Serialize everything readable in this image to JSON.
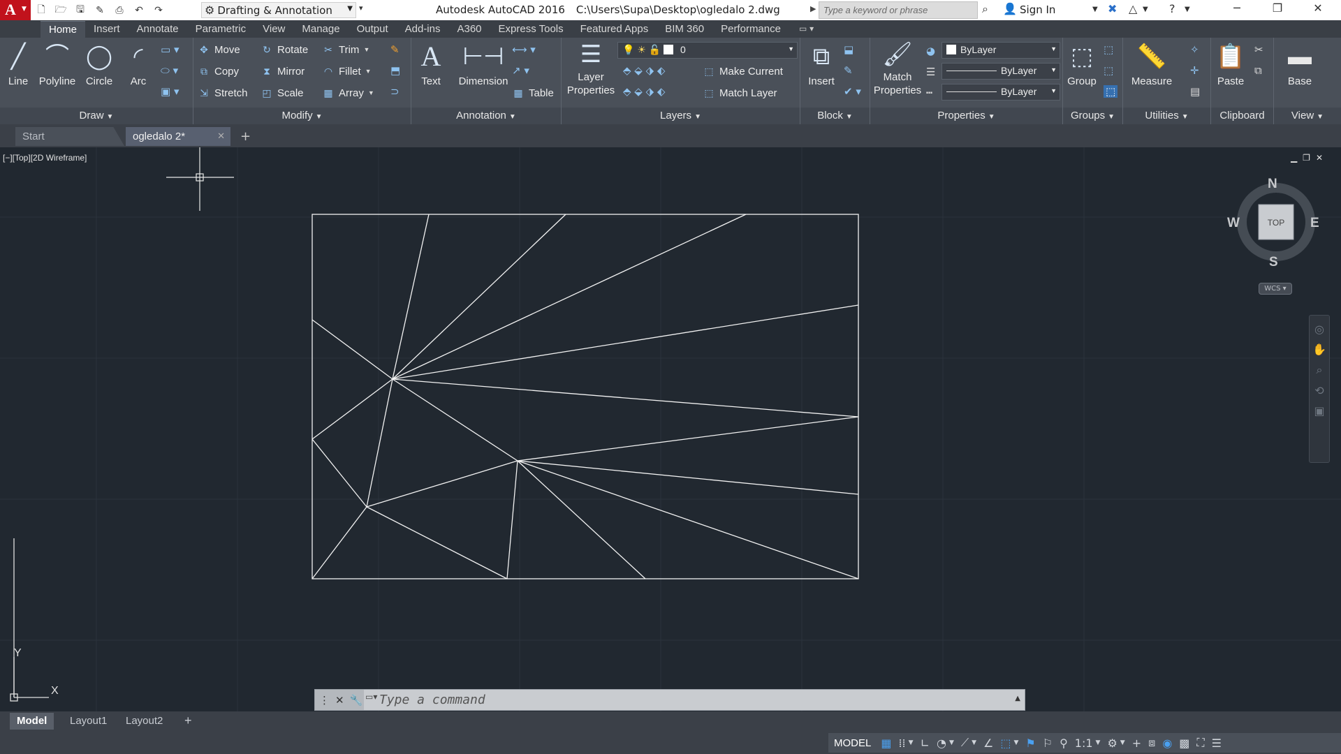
{
  "titlebar": {
    "app_name": "Autodesk AutoCAD 2016",
    "file_path": "C:\\Users\\Supa\\Desktop\\ogledalo 2.dwg",
    "workspace": "Drafting & Annotation",
    "search_placeholder": "Type a keyword or phrase",
    "sign_in": "Sign In",
    "app_logo_letter": "A"
  },
  "ribbon_tabs": [
    "Home",
    "Insert",
    "Annotate",
    "Parametric",
    "View",
    "Manage",
    "Output",
    "Add-ins",
    "A360",
    "Express Tools",
    "Featured Apps",
    "BIM 360",
    "Performance"
  ],
  "panels": {
    "draw": {
      "title": "Draw",
      "line": "Line",
      "polyline": "Polyline",
      "circle": "Circle",
      "arc": "Arc"
    },
    "modify": {
      "title": "Modify",
      "move": "Move",
      "rotate": "Rotate",
      "trim": "Trim",
      "copy": "Copy",
      "mirror": "Mirror",
      "fillet": "Fillet",
      "stretch": "Stretch",
      "scale": "Scale",
      "array": "Array"
    },
    "annotation": {
      "title": "Annotation",
      "text": "Text",
      "dimension": "Dimension",
      "table": "Table"
    },
    "layers": {
      "title": "Layers",
      "layer_properties_1": "Layer",
      "layer_properties_2": "Properties",
      "current_layer": "0",
      "make_current": "Make Current",
      "match_layer": "Match Layer"
    },
    "block": {
      "title": "Block",
      "insert": "Insert"
    },
    "properties": {
      "title": "Properties",
      "match_1": "Match",
      "match_2": "Properties",
      "color": "ByLayer",
      "lineweight": "ByLayer",
      "linetype": "ByLayer"
    },
    "groups": {
      "title": "Groups",
      "group": "Group"
    },
    "utilities": {
      "title": "Utilities",
      "measure": "Measure"
    },
    "clipboard": {
      "title": "Clipboard",
      "paste": "Paste"
    },
    "view": {
      "title": "View",
      "base": "Base"
    }
  },
  "file_tabs": {
    "start": "Start",
    "document": "ogledalo 2*"
  },
  "viewport": {
    "label": "[−][Top][2D Wireframe]",
    "viewcube_face": "TOP",
    "compass": {
      "north": "N",
      "south": "S",
      "east": "E",
      "west": "W"
    },
    "wcs": "WCS",
    "ucs_x": "X",
    "ucs_y": "Y"
  },
  "command_line": {
    "placeholder": "Type a command"
  },
  "layout_tabs": [
    "Model",
    "Layout1",
    "Layout2"
  ],
  "status": {
    "model": "MODEL",
    "scale": "1:1"
  },
  "colors": {
    "canvas_bg": "#212830",
    "ribbon_bg": "#4a5059",
    "geometry_stroke": "#ffffff",
    "accent_blue": "#4aa0f0",
    "autodesk_red": "#c1121c"
  },
  "icons": {
    "qat": [
      "new-icon",
      "open-icon",
      "save-icon",
      "saveas-icon",
      "print-icon",
      "undo-icon",
      "redo-icon"
    ],
    "status": [
      "grid-icon",
      "snap-icon",
      "ortho-icon",
      "polar-icon",
      "isodraft-icon",
      "osnap-icon",
      "annotation-scale-icon",
      "settings-icon",
      "plus-icon",
      "fullscreen-icon",
      "menu-icon"
    ]
  }
}
